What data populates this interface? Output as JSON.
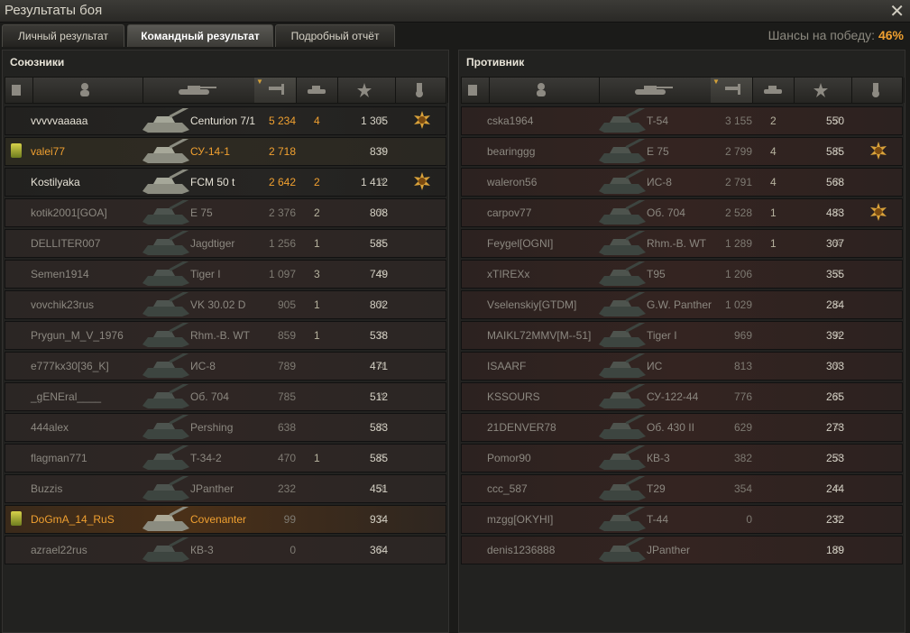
{
  "window": {
    "title": "Результаты боя"
  },
  "tabs": [
    {
      "label": "Личный результат",
      "active": false
    },
    {
      "label": "Командный результат",
      "active": true
    },
    {
      "label": "Подробный отчёт",
      "active": false
    }
  ],
  "win_chance": {
    "label": "Шансы на победу:",
    "value": "46%"
  },
  "allies": {
    "title": "Союзники",
    "players": [
      {
        "name": "vvvvvaaaaa",
        "tank": "Centurion 7/1",
        "damage": "5 234",
        "frags": "4",
        "xp": "1 305",
        "state": "alive",
        "medal": true
      },
      {
        "name": "valei77",
        "tank": "СУ-14-1",
        "damage": "2 718",
        "frags": "",
        "xp": "839",
        "state": "squad",
        "squad": true
      },
      {
        "name": "Kostilyaka",
        "tank": "FCM 50 t",
        "damage": "2 642",
        "frags": "2",
        "xp": "1 412",
        "state": "alive",
        "medal": true
      },
      {
        "name": "kotik2001[GOA]",
        "tank": "E 75",
        "damage": "2 376",
        "frags": "2",
        "xp": "808",
        "state": "dead"
      },
      {
        "name": "DELLITER007",
        "tank": "Jagdtiger",
        "damage": "1 256",
        "frags": "1",
        "xp": "585",
        "state": "dead"
      },
      {
        "name": "Semen1914",
        "tank": "Tiger I",
        "damage": "1 097",
        "frags": "3",
        "xp": "749",
        "state": "dead"
      },
      {
        "name": "vovchik23rus",
        "tank": "VK 30.02 D",
        "damage": "905",
        "frags": "1",
        "xp": "802",
        "state": "dead"
      },
      {
        "name": "Prygun_M_V_1976",
        "tank": "Rhm.-B. WT",
        "damage": "859",
        "frags": "1",
        "xp": "538",
        "state": "dead"
      },
      {
        "name": "e777kx30[36_K]",
        "tank": "ИС-8",
        "damage": "789",
        "frags": "",
        "xp": "471",
        "state": "dead"
      },
      {
        "name": "_gENEral____",
        "tank": "Об. 704",
        "damage": "785",
        "frags": "",
        "xp": "512",
        "state": "dead"
      },
      {
        "name": "444alex",
        "tank": "Pershing",
        "damage": "638",
        "frags": "",
        "xp": "583",
        "state": "dead"
      },
      {
        "name": "flagman771",
        "tank": "T-34-2",
        "damage": "470",
        "frags": "1",
        "xp": "585",
        "state": "dead"
      },
      {
        "name": "Buzzis",
        "tank": "JPanther",
        "damage": "232",
        "frags": "",
        "xp": "451",
        "state": "dead"
      },
      {
        "name": "DoGmA_14_RuS",
        "tank": "Covenanter",
        "damage": "99",
        "frags": "",
        "xp": "934",
        "state": "me",
        "squad": true
      },
      {
        "name": "azrael22rus",
        "tank": "КВ-3",
        "damage": "0",
        "frags": "",
        "xp": "364",
        "state": "dead"
      }
    ]
  },
  "enemies": {
    "title": "Противник",
    "players": [
      {
        "name": "cska1964",
        "tank": "T-54",
        "damage": "3 155",
        "frags": "2",
        "xp": "550",
        "state": "dead"
      },
      {
        "name": "bearinggg",
        "tank": "E 75",
        "damage": "2 799",
        "frags": "4",
        "xp": "585",
        "state": "dead",
        "medal": true
      },
      {
        "name": "waleron56",
        "tank": "ИС-8",
        "damage": "2 791",
        "frags": "4",
        "xp": "568",
        "state": "dead"
      },
      {
        "name": "carpov77",
        "tank": "Об. 704",
        "damage": "2 528",
        "frags": "1",
        "xp": "483",
        "state": "dead",
        "medal": true
      },
      {
        "name": "Feygel[OGNI]",
        "tank": "Rhm.-B. WT",
        "damage": "1 289",
        "frags": "1",
        "xp": "307",
        "state": "dead"
      },
      {
        "name": "xTIREXx",
        "tank": "T95",
        "damage": "1 206",
        "frags": "",
        "xp": "355",
        "state": "dead"
      },
      {
        "name": "Vselenskiy[GTDM]",
        "tank": "G.W. Panther",
        "damage": "1 029",
        "frags": "",
        "xp": "284",
        "state": "dead"
      },
      {
        "name": "MAIKL72MMV[M--51]",
        "tank": "Tiger I",
        "damage": "969",
        "frags": "",
        "xp": "392",
        "state": "dead"
      },
      {
        "name": "ISAARF",
        "tank": "ИС",
        "damage": "813",
        "frags": "",
        "xp": "303",
        "state": "dead"
      },
      {
        "name": "KSSOURS",
        "tank": "СУ-122-44",
        "damage": "776",
        "frags": "",
        "xp": "265",
        "state": "dead"
      },
      {
        "name": "21DENVER78",
        "tank": "Об. 430 II",
        "damage": "629",
        "frags": "",
        "xp": "273",
        "state": "dead"
      },
      {
        "name": "Pomor90",
        "tank": "КВ-3",
        "damage": "382",
        "frags": "",
        "xp": "253",
        "state": "dead"
      },
      {
        "name": "ccc_587",
        "tank": "T29",
        "damage": "354",
        "frags": "",
        "xp": "244",
        "state": "dead"
      },
      {
        "name": "mzgg[OKYHI]",
        "tank": "T-44",
        "damage": "0",
        "frags": "",
        "xp": "232",
        "state": "dead"
      },
      {
        "name": "denis1236888",
        "tank": "JPanther",
        "damage": "",
        "frags": "",
        "xp": "189",
        "state": "dead"
      }
    ]
  },
  "colors": {
    "accent": "#f0a030",
    "text": "#c9c5b8",
    "dead_row": "#2f2624",
    "alive_row": "#262523"
  },
  "icons": {
    "star": "☆",
    "close": "✕"
  }
}
